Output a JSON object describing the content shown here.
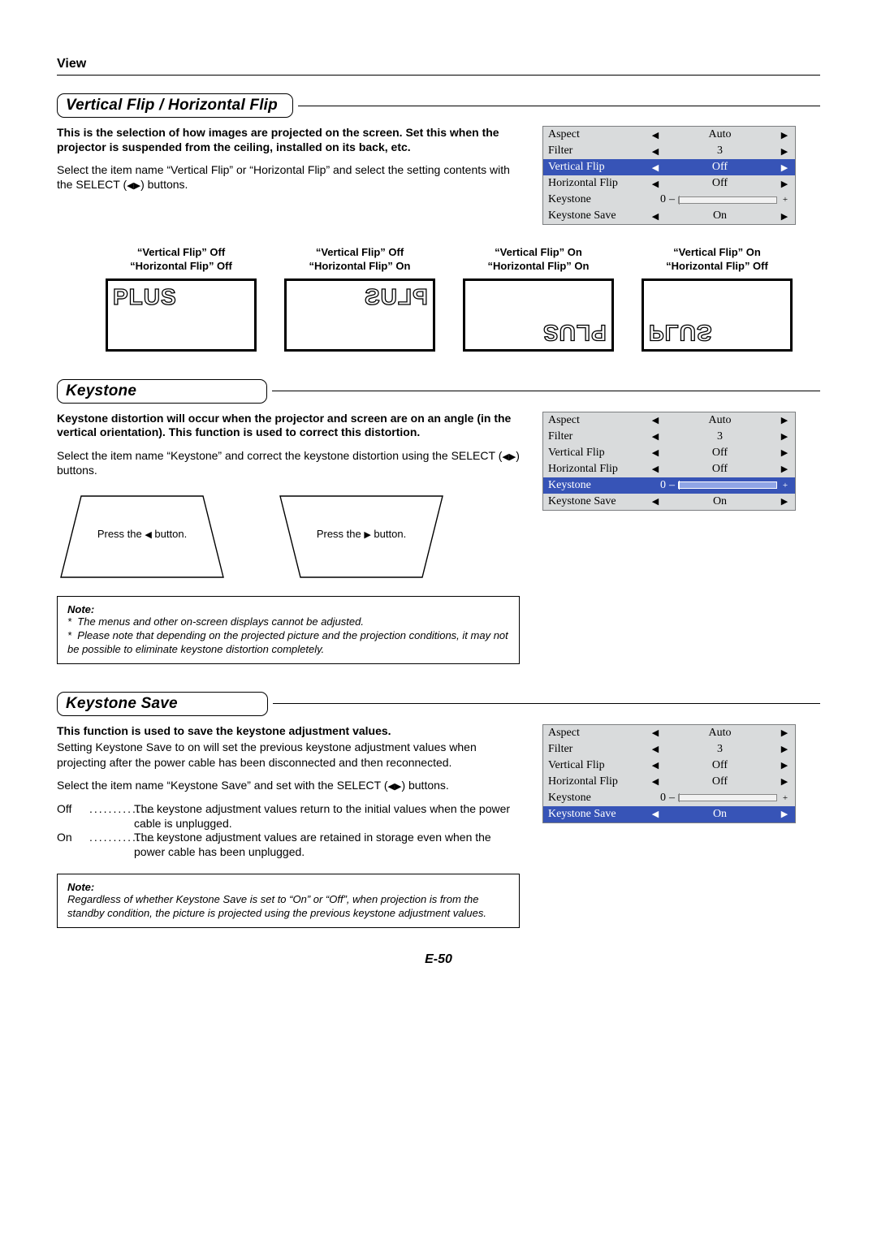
{
  "header": {
    "view": "View"
  },
  "sections": {
    "vflip": {
      "title": "Vertical Flip / Horizontal Flip",
      "bold": "This is the selection of how images are projected on the screen. Set this when the projector is suspended from the ceiling, installed on its back, etc.",
      "para_a": "Select the item name “Vertical Flip” or “Horizontal Flip” and select the setting contents with the SELECT (",
      "para_b": ") buttons."
    },
    "keystone": {
      "title": "Keystone",
      "bold": "Keystone distortion will occur when the projector and screen are on an angle (in the vertical orientation). This function is used to correct this distortion.",
      "para_a": "Select the item name “Keystone” and correct the keystone distortion using the SELECT (",
      "para_b": ") buttons.",
      "trap_left_a": "Press the ",
      "trap_left_b": " button.",
      "trap_right_a": "Press the ",
      "trap_right_b": " button.",
      "note_title": "Note:",
      "note1": "The menus and other on-screen displays cannot be adjusted.",
      "note2": "Please note that depending on the projected picture and the projection conditions, it may not be possible to eliminate keystone distortion completely."
    },
    "ksave": {
      "title": "Keystone Save",
      "bold": "This function is used to save the keystone adjustment values.",
      "para1": "Setting Keystone Save to on will set the previous keystone adjustment values when projecting after the power cable has been disconnected and then reconnected.",
      "para2_a": "Select the item name “Keystone Save” and set with the SELECT (",
      "para2_b": ") buttons.",
      "off_term": "Off",
      "off_body": "The keystone adjustment values return to the initial values when the power cable is unplugged.",
      "on_term": "On",
      "on_body": "The keystone adjustment values are retained in storage even when the power cable has been unplugged.",
      "note_title": "Note:",
      "note": "Regardless of whether Keystone Save is set to “On” or “Off”, when projection is from the standby condition, the picture is projected using the previous keystone adjustment values."
    }
  },
  "flip_labels": {
    "a1": "“Vertical Flip” Off",
    "a2": "“Horizontal Flip” Off",
    "b1": "“Vertical Flip” Off",
    "b2": "“Horizontal Flip” On",
    "c1": "“Vertical Flip” On",
    "c2": "“Horizontal Flip” On",
    "d1": "“Vertical Flip” On",
    "d2": "“Horizontal Flip” Off",
    "word": "PLUS"
  },
  "menu": {
    "aspect": {
      "label": "Aspect",
      "value": "Auto"
    },
    "filter": {
      "label": "Filter",
      "value": "3"
    },
    "vflip": {
      "label": "Vertical Flip",
      "value": "Off"
    },
    "hflip": {
      "label": "Horizontal Flip",
      "value": "Off"
    },
    "keystone": {
      "label": "Keystone",
      "num": "0"
    },
    "ksave": {
      "label": "Keystone Save",
      "value": "On"
    }
  },
  "glyphs": {
    "left": "◀",
    "right": "▶",
    "plus": "+",
    "minus": "–",
    "star": "*"
  },
  "footer": {
    "page": "E-50"
  }
}
